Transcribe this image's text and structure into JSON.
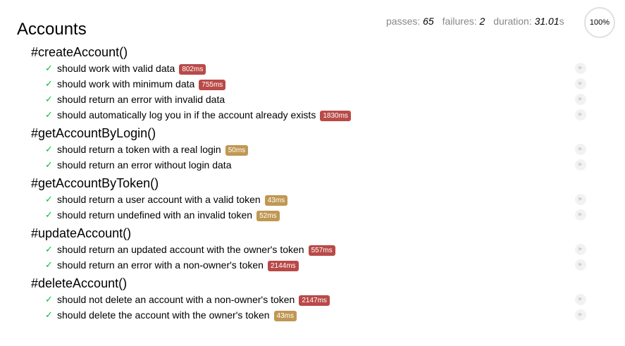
{
  "stats": {
    "passes_label": "passes:",
    "passes": "65",
    "failures_label": "failures:",
    "failures": "2",
    "duration_label": "duration:",
    "duration": "31.01",
    "duration_unit": "s",
    "progress": "100%"
  },
  "suite": {
    "title": "Accounts",
    "groups": [
      {
        "title": "#createAccount()",
        "tests": [
          {
            "name": "should work with valid data",
            "duration": "802ms",
            "speed": "slow"
          },
          {
            "name": "should work with minimum data",
            "duration": "755ms",
            "speed": "slow"
          },
          {
            "name": "should return an error with invalid data",
            "duration": "",
            "speed": ""
          },
          {
            "name": "should automatically log you in if the account already exists",
            "duration": "1830ms",
            "speed": "slow"
          }
        ]
      },
      {
        "title": "#getAccountByLogin()",
        "tests": [
          {
            "name": "should return a token with a real login",
            "duration": "50ms",
            "speed": "medium"
          },
          {
            "name": "should return an error without login data",
            "duration": "",
            "speed": ""
          }
        ]
      },
      {
        "title": "#getAccountByToken()",
        "tests": [
          {
            "name": "should return a user account with a valid token",
            "duration": "43ms",
            "speed": "medium"
          },
          {
            "name": "should return undefined with an invalid token",
            "duration": "52ms",
            "speed": "medium"
          }
        ]
      },
      {
        "title": "#updateAccount()",
        "tests": [
          {
            "name": "should return an updated account with the owner's token",
            "duration": "557ms",
            "speed": "slow"
          },
          {
            "name": "should return an error with a non-owner's token",
            "duration": "2144ms",
            "speed": "slow"
          }
        ]
      },
      {
        "title": "#deleteAccount()",
        "tests": [
          {
            "name": "should not delete an account with a non-owner's token",
            "duration": "2147ms",
            "speed": "slow"
          },
          {
            "name": "should delete the account with the owner's token",
            "duration": "43ms",
            "speed": "medium"
          }
        ]
      }
    ]
  },
  "icons": {
    "pass": "checkmark-icon",
    "replay": "replay-icon",
    "check_glyph": "✓",
    "replay_glyph": "▶"
  },
  "colors": {
    "pass": "#00c23a",
    "slow": "#b94a48",
    "medium": "#c09853",
    "muted": "#888888"
  }
}
